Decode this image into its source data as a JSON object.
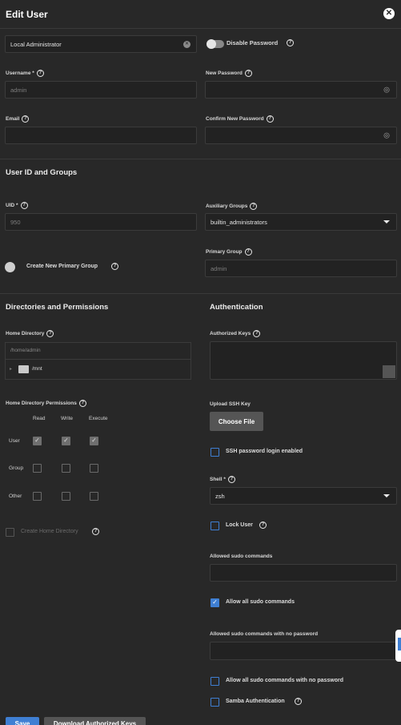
{
  "header": {
    "title": "Edit User",
    "close_icon": "close-icon"
  },
  "full_name": {
    "value": "Local Administrator"
  },
  "disable_password": {
    "label": "Disable Password"
  },
  "username": {
    "label": "Username *",
    "value": "admin"
  },
  "new_password": {
    "label": "New Password",
    "value": ""
  },
  "email": {
    "label": "Email",
    "value": ""
  },
  "confirm_password": {
    "label": "Confirm New Password",
    "value": ""
  },
  "section_ids": {
    "title": "User ID and Groups"
  },
  "uid": {
    "label": "UID *",
    "value": "950"
  },
  "aux_groups": {
    "label": "Auxiliary Groups",
    "value": "builtin_administrators"
  },
  "create_primary_group": {
    "label": "Create New Primary Group"
  },
  "primary_group": {
    "label": "Primary Group",
    "value": "admin"
  },
  "section_dirs": {
    "title": "Directories and Permissions"
  },
  "section_auth": {
    "title": "Authentication"
  },
  "home_dir": {
    "label": "Home Directory",
    "value": "/home/admin",
    "tree_item": "/mnt"
  },
  "authorized_keys": {
    "label": "Authorized Keys"
  },
  "perms": {
    "label": "Home Directory Permissions",
    "cols": [
      "Read",
      "Write",
      "Execute"
    ],
    "rows": [
      {
        "name": "User",
        "checks": [
          true,
          true,
          true
        ]
      },
      {
        "name": "Group",
        "checks": [
          false,
          false,
          false
        ]
      },
      {
        "name": "Other",
        "checks": [
          false,
          false,
          false
        ]
      }
    ]
  },
  "upload_ssh": {
    "label": "Upload SSH Key",
    "button": "Choose File"
  },
  "ssh_password_login": {
    "label": "SSH password login enabled",
    "checked": false
  },
  "create_home": {
    "label": "Create Home Directory"
  },
  "shell": {
    "label": "Shell *",
    "value": "zsh"
  },
  "lock_user": {
    "label": "Lock User",
    "checked": false
  },
  "sudo_commands": {
    "label": "Allowed sudo commands",
    "value": ""
  },
  "allow_all_sudo": {
    "label": "Allow all sudo commands",
    "checked": true
  },
  "sudo_nopasswd": {
    "label": "Allowed sudo commands with no password",
    "value": ""
  },
  "allow_all_sudo_nopasswd": {
    "label": "Allow all sudo commands with no password",
    "checked": false
  },
  "samba_auth": {
    "label": "Samba Authentication",
    "checked": false
  },
  "footer": {
    "save_label": "Save",
    "second_label": "Download Authorized Keys"
  },
  "colors": {
    "accent": "#3f7fd3",
    "background": "#282828"
  }
}
